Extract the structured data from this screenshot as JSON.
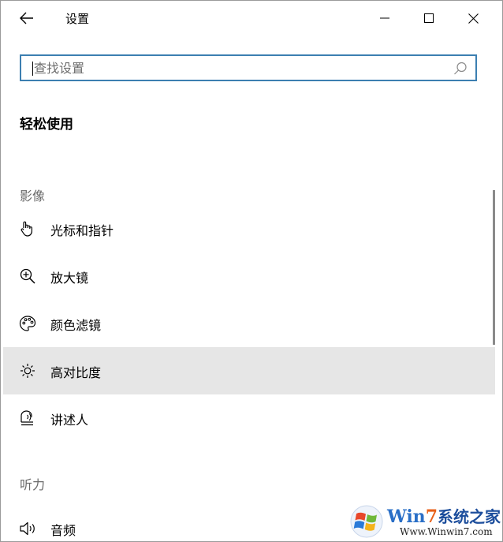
{
  "window": {
    "title": "设置"
  },
  "search": {
    "placeholder": "查找设置",
    "value": ""
  },
  "page": {
    "title": "轻松使用"
  },
  "groups": [
    {
      "header": "影像",
      "items": [
        {
          "label": "光标和指针",
          "icon": "pointer-hand-icon",
          "selected": false
        },
        {
          "label": "放大镜",
          "icon": "magnifier-icon",
          "selected": false
        },
        {
          "label": "颜色滤镜",
          "icon": "color-palette-icon",
          "selected": false
        },
        {
          "label": "高对比度",
          "icon": "brightness-icon",
          "selected": true
        },
        {
          "label": "讲述人",
          "icon": "narrator-icon",
          "selected": false
        }
      ]
    },
    {
      "header": "听力",
      "items": [
        {
          "label": "音频",
          "icon": "speaker-icon",
          "selected": false
        }
      ]
    }
  ],
  "watermark": {
    "brand_part1": "Win",
    "brand_part2": "7",
    "brand_part3": "系统之家",
    "url": "Www.Winwin7.com"
  },
  "colors": {
    "accent": "#3c7fb1",
    "selected_bg": "#e6e6e6",
    "group_header": "#6a6a6a"
  }
}
